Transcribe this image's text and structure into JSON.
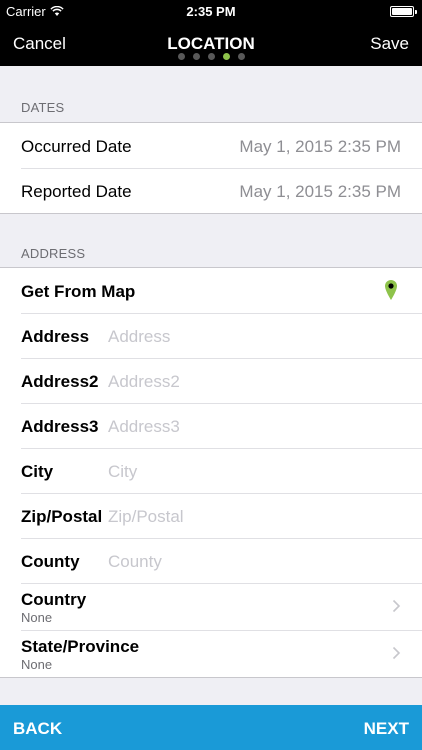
{
  "status_bar": {
    "carrier": "Carrier",
    "time": "2:35 PM",
    "wifi_icon": "wifi-icon",
    "battery_icon": "battery-icon"
  },
  "nav": {
    "cancel_label": "Cancel",
    "title": "LOCATION",
    "save_label": "Save",
    "page_dots": 5,
    "active_dot": 4,
    "active_dot_color": "#8ec34b"
  },
  "dates": {
    "header": "DATES",
    "occurred": {
      "label": "Occurred Date",
      "value": "May 1, 2015 2:35 PM"
    },
    "reported": {
      "label": "Reported Date",
      "value": "May 1, 2015 2:35 PM"
    }
  },
  "address": {
    "header": "ADDRESS",
    "get_from_map": {
      "label": "Get From Map",
      "icon": "map-pin-icon",
      "icon_color": "#8ec34b"
    },
    "fields": [
      {
        "label": "Address",
        "placeholder": "Address",
        "value": ""
      },
      {
        "label": "Address2",
        "placeholder": "Address2",
        "value": ""
      },
      {
        "label": "Address3",
        "placeholder": "Address3",
        "value": ""
      },
      {
        "label": "City",
        "placeholder": "City",
        "value": ""
      },
      {
        "label": "Zip/Postal",
        "placeholder": "Zip/Postal",
        "value": ""
      },
      {
        "label": "County",
        "placeholder": "County",
        "value": ""
      }
    ],
    "country": {
      "label": "Country",
      "value": "None"
    },
    "state": {
      "label": "State/Province",
      "value": "None"
    }
  },
  "bottom_bar": {
    "back_label": "BACK",
    "next_label": "NEXT",
    "color": "#1a9ad7"
  }
}
